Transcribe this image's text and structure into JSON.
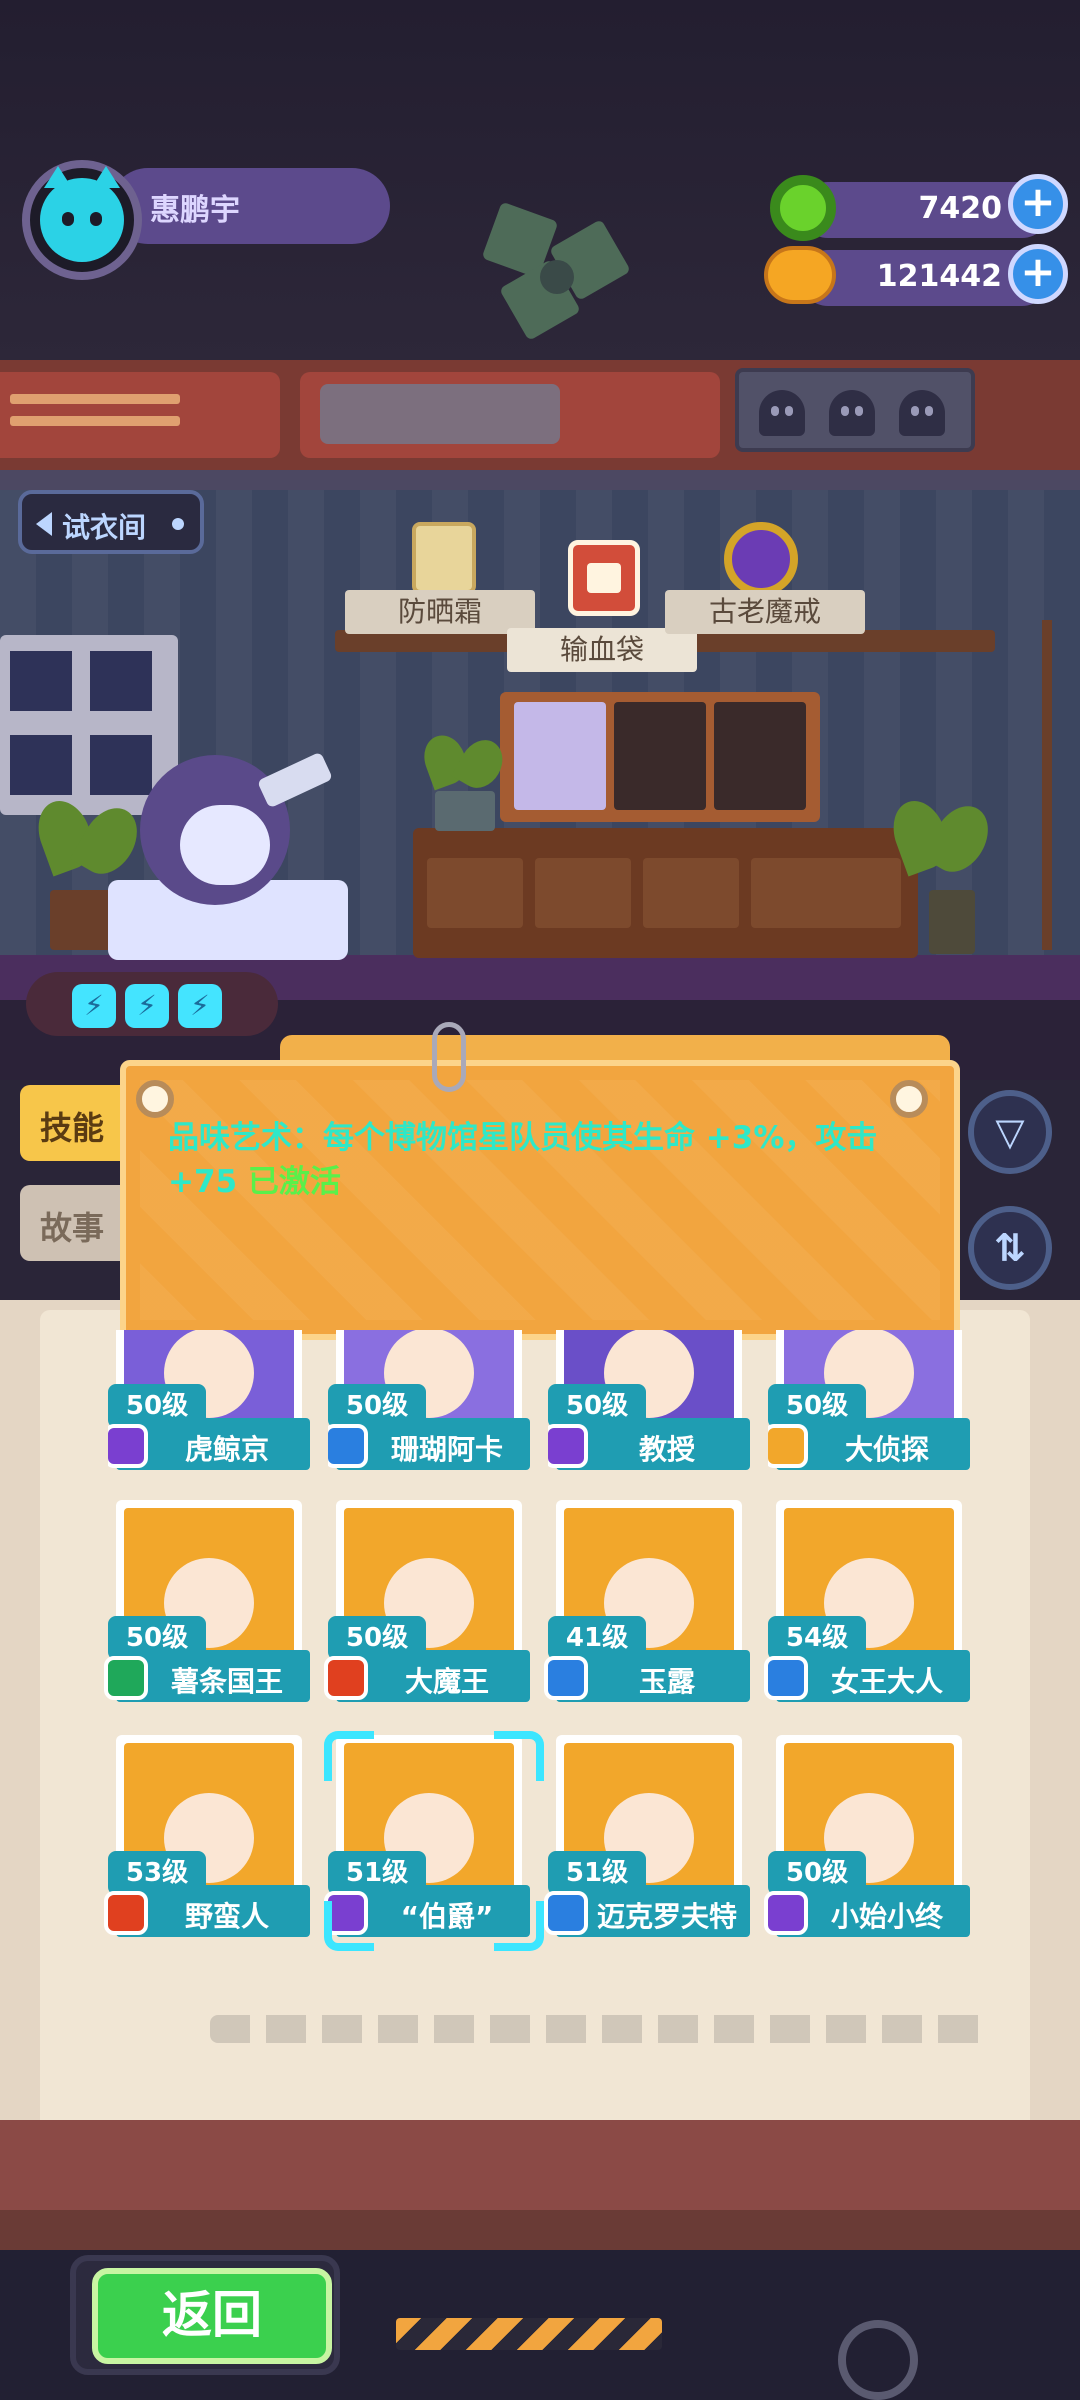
{
  "player": {
    "name": "惠鹏宇",
    "avatar_icon": "cat-face-icon"
  },
  "currency": [
    {
      "icon": "donut-coin-icon",
      "value": "7420",
      "color": "#6ad22c"
    },
    {
      "icon": "planet-coin-icon",
      "value": "121442",
      "color": "#f5a623"
    }
  ],
  "room": {
    "fitting_room_label": "试衣间",
    "items": {
      "sunscreen_label": "防晒霜",
      "blood_bag_label": "输血袋",
      "ring_label": "古老魔戒"
    },
    "energy_count": 3
  },
  "tabs": {
    "skill_label": "技能",
    "story_label": "故事",
    "active": "skill"
  },
  "skill": {
    "text": "品味艺术：每个博物馆星队员使其生命 ",
    "hp_bonus": "+3%",
    "mid": "，攻击 ",
    "atk_bonus": "+75",
    "status": " 已激活"
  },
  "side_buttons": {
    "filter_icon": "filter-icon",
    "sort_icon": "sort-icon"
  },
  "characters": [
    {
      "name": "虎鲸京",
      "level": "50级",
      "class_color": "#7a3fd0",
      "bg": "#7a5fd8",
      "selected": false
    },
    {
      "name": "珊瑚阿卡",
      "level": "50级",
      "class_color": "#2a7fe0",
      "bg": "#8a6fe0",
      "selected": false
    },
    {
      "name": "教授",
      "level": "50级",
      "class_color": "#7a3fd0",
      "bg": "#6a4fc8",
      "selected": false
    },
    {
      "name": "大侦探",
      "level": "50级",
      "class_color": "#f2a72b",
      "bg": "#8a6fe0",
      "selected": false
    },
    {
      "name": "薯条国王",
      "level": "50级",
      "class_color": "#1fa85a",
      "bg": "#f2a72b",
      "selected": false
    },
    {
      "name": "大魔王",
      "level": "50级",
      "class_color": "#e0401f",
      "bg": "#f2a72b",
      "selected": false
    },
    {
      "name": "玉露",
      "level": "41级",
      "class_color": "#2a7fe0",
      "bg": "#f2a72b",
      "selected": false
    },
    {
      "name": "女王大人",
      "level": "54级",
      "class_color": "#2a7fe0",
      "bg": "#f2a72b",
      "selected": false
    },
    {
      "name": "野蛮人",
      "level": "53级",
      "class_color": "#e0401f",
      "bg": "#f2a72b",
      "selected": false
    },
    {
      "name": "“伯爵”",
      "level": "51级",
      "class_color": "#7a3fd0",
      "bg": "#f2a72b",
      "selected": true
    },
    {
      "name": "迈克罗夫特",
      "level": "51级",
      "class_color": "#2a7fe0",
      "bg": "#f2a72b",
      "selected": false
    },
    {
      "name": "小始小终",
      "level": "50级",
      "class_color": "#7a3fd0",
      "bg": "#f2a72b",
      "selected": false
    }
  ],
  "footer": {
    "back_label": "返回"
  }
}
